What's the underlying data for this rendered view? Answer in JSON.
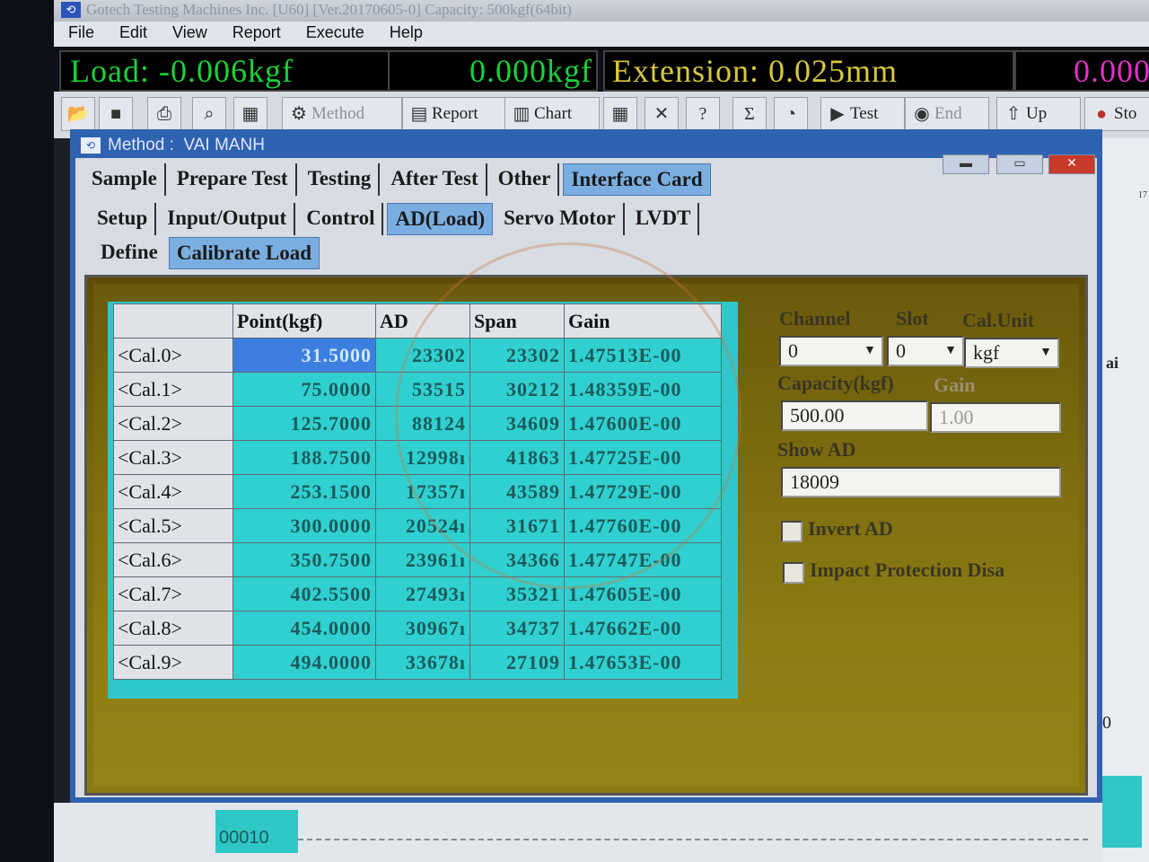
{
  "title_bar": {
    "icon": "app-icon",
    "text": "Gotech Testing Machines Inc. [U60] [Ver.20170605-0] Capacity: 500kgf(64bit)"
  },
  "menu": [
    "File",
    "Edit",
    "View",
    "Report",
    "Execute",
    "Help"
  ],
  "readouts": {
    "load": "Load: -0.006kgf",
    "peak": "0.000kgf",
    "extension": "Extension: 0.025mm",
    "extra": "0.000"
  },
  "toolbar": {
    "method_label": "Method",
    "report_label": "Report",
    "chart_label": "Chart",
    "test_label": "Test",
    "end_label": "End",
    "up_label": "Up",
    "stop_label": "Sto"
  },
  "method_window": {
    "title": "Method :  VAI MANH",
    "tabs_row1": [
      "Sample",
      "Prepare Test",
      "Testing",
      "After Test",
      "Other",
      "Interface Card"
    ],
    "tabs_row2": [
      "Setup",
      "Input/Output",
      "Control",
      "AD(Load)",
      "Servo Motor",
      "LVDT"
    ],
    "tabs_row3": [
      "Define",
      "Calibrate Load"
    ]
  },
  "calibration_table": {
    "headers": [
      "Point(kgf)",
      "AD",
      "Span",
      "Gain"
    ],
    "rows": [
      {
        "label": "<Cal.0>",
        "point": "31.5000",
        "ad": "23302",
        "span": "23302",
        "gain": "1.47513E-00"
      },
      {
        "label": "<Cal.1>",
        "point": "75.0000",
        "ad": "53515",
        "span": "30212",
        "gain": "1.48359E-00"
      },
      {
        "label": "<Cal.2>",
        "point": "125.7000",
        "ad": "88124",
        "span": "34609",
        "gain": "1.47600E-00"
      },
      {
        "label": "<Cal.3>",
        "point": "188.7500",
        "ad": "12998ı",
        "span": "41863",
        "gain": "1.47725E-00"
      },
      {
        "label": "<Cal.4>",
        "point": "253.1500",
        "ad": "17357ı",
        "span": "43589",
        "gain": "1.47729E-00"
      },
      {
        "label": "<Cal.5>",
        "point": "300.0000",
        "ad": "20524ı",
        "span": "31671",
        "gain": "1.47760E-00"
      },
      {
        "label": "<Cal.6>",
        "point": "350.7500",
        "ad": "23961ı",
        "span": "34366",
        "gain": "1.47747E-00"
      },
      {
        "label": "<Cal.7>",
        "point": "402.5500",
        "ad": "27493ı",
        "span": "35321",
        "gain": "1.47605E-00"
      },
      {
        "label": "<Cal.8>",
        "point": "454.0000",
        "ad": "30967ı",
        "span": "34737",
        "gain": "1.47662E-00"
      },
      {
        "label": "<Cal.9>",
        "point": "494.0000",
        "ad": "33678ı",
        "span": "27109",
        "gain": "1.47653E-00"
      }
    ]
  },
  "settings": {
    "channel_label": "Channel",
    "slot_label": "Slot",
    "cal_unit_label": "Cal.Unit",
    "channel_value": "0",
    "slot_value": "0",
    "cal_unit_value": "kgf",
    "capacity_label": "Capacity(kgf)",
    "gain_label": "Gain",
    "capacity_value": "500.00",
    "gain_value": "1.00",
    "show_ad_label": "Show AD",
    "show_ad_value": "18009",
    "invert_ad_label": "Invert AD",
    "impact_protection_label": "Impact Protection Disa"
  },
  "background": {
    "right_tick": "17",
    "right_text": "ai",
    "right_text2": "0",
    "bottom_counter": "00010"
  },
  "colors": {
    "grid_cyan": "#2fd0cf",
    "selected_cell": "#3c7fe0",
    "panel_olive": "#8a7a10",
    "load_green": "#18d23a",
    "extension_yellow": "#d8c83a",
    "extra_magenta": "#e030c8"
  }
}
